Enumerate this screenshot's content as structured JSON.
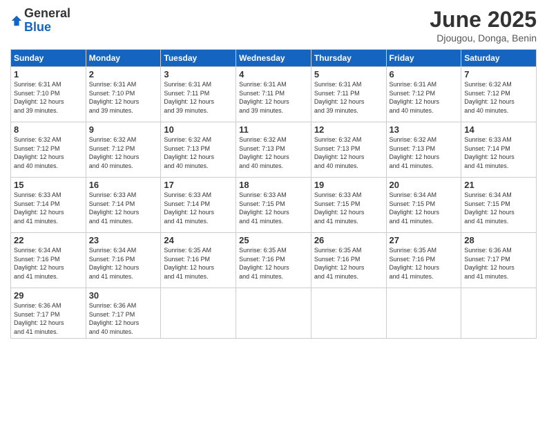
{
  "logo": {
    "general": "General",
    "blue": "Blue"
  },
  "header": {
    "month": "June 2025",
    "location": "Djougou, Donga, Benin"
  },
  "days_of_week": [
    "Sunday",
    "Monday",
    "Tuesday",
    "Wednesday",
    "Thursday",
    "Friday",
    "Saturday"
  ],
  "weeks": [
    [
      {
        "day": "1",
        "sunrise": "6:31 AM",
        "sunset": "7:10 PM",
        "daylight": "12 hours and 39 minutes."
      },
      {
        "day": "2",
        "sunrise": "6:31 AM",
        "sunset": "7:10 PM",
        "daylight": "12 hours and 39 minutes."
      },
      {
        "day": "3",
        "sunrise": "6:31 AM",
        "sunset": "7:11 PM",
        "daylight": "12 hours and 39 minutes."
      },
      {
        "day": "4",
        "sunrise": "6:31 AM",
        "sunset": "7:11 PM",
        "daylight": "12 hours and 39 minutes."
      },
      {
        "day": "5",
        "sunrise": "6:31 AM",
        "sunset": "7:11 PM",
        "daylight": "12 hours and 39 minutes."
      },
      {
        "day": "6",
        "sunrise": "6:31 AM",
        "sunset": "7:12 PM",
        "daylight": "12 hours and 40 minutes."
      },
      {
        "day": "7",
        "sunrise": "6:32 AM",
        "sunset": "7:12 PM",
        "daylight": "12 hours and 40 minutes."
      }
    ],
    [
      {
        "day": "8",
        "sunrise": "6:32 AM",
        "sunset": "7:12 PM",
        "daylight": "12 hours and 40 minutes."
      },
      {
        "day": "9",
        "sunrise": "6:32 AM",
        "sunset": "7:12 PM",
        "daylight": "12 hours and 40 minutes."
      },
      {
        "day": "10",
        "sunrise": "6:32 AM",
        "sunset": "7:13 PM",
        "daylight": "12 hours and 40 minutes."
      },
      {
        "day": "11",
        "sunrise": "6:32 AM",
        "sunset": "7:13 PM",
        "daylight": "12 hours and 40 minutes."
      },
      {
        "day": "12",
        "sunrise": "6:32 AM",
        "sunset": "7:13 PM",
        "daylight": "12 hours and 40 minutes."
      },
      {
        "day": "13",
        "sunrise": "6:32 AM",
        "sunset": "7:13 PM",
        "daylight": "12 hours and 41 minutes."
      },
      {
        "day": "14",
        "sunrise": "6:33 AM",
        "sunset": "7:14 PM",
        "daylight": "12 hours and 41 minutes."
      }
    ],
    [
      {
        "day": "15",
        "sunrise": "6:33 AM",
        "sunset": "7:14 PM",
        "daylight": "12 hours and 41 minutes."
      },
      {
        "day": "16",
        "sunrise": "6:33 AM",
        "sunset": "7:14 PM",
        "daylight": "12 hours and 41 minutes."
      },
      {
        "day": "17",
        "sunrise": "6:33 AM",
        "sunset": "7:14 PM",
        "daylight": "12 hours and 41 minutes."
      },
      {
        "day": "18",
        "sunrise": "6:33 AM",
        "sunset": "7:15 PM",
        "daylight": "12 hours and 41 minutes."
      },
      {
        "day": "19",
        "sunrise": "6:33 AM",
        "sunset": "7:15 PM",
        "daylight": "12 hours and 41 minutes."
      },
      {
        "day": "20",
        "sunrise": "6:34 AM",
        "sunset": "7:15 PM",
        "daylight": "12 hours and 41 minutes."
      },
      {
        "day": "21",
        "sunrise": "6:34 AM",
        "sunset": "7:15 PM",
        "daylight": "12 hours and 41 minutes."
      }
    ],
    [
      {
        "day": "22",
        "sunrise": "6:34 AM",
        "sunset": "7:16 PM",
        "daylight": "12 hours and 41 minutes."
      },
      {
        "day": "23",
        "sunrise": "6:34 AM",
        "sunset": "7:16 PM",
        "daylight": "12 hours and 41 minutes."
      },
      {
        "day": "24",
        "sunrise": "6:35 AM",
        "sunset": "7:16 PM",
        "daylight": "12 hours and 41 minutes."
      },
      {
        "day": "25",
        "sunrise": "6:35 AM",
        "sunset": "7:16 PM",
        "daylight": "12 hours and 41 minutes."
      },
      {
        "day": "26",
        "sunrise": "6:35 AM",
        "sunset": "7:16 PM",
        "daylight": "12 hours and 41 minutes."
      },
      {
        "day": "27",
        "sunrise": "6:35 AM",
        "sunset": "7:16 PM",
        "daylight": "12 hours and 41 minutes."
      },
      {
        "day": "28",
        "sunrise": "6:36 AM",
        "sunset": "7:17 PM",
        "daylight": "12 hours and 41 minutes."
      }
    ],
    [
      {
        "day": "29",
        "sunrise": "6:36 AM",
        "sunset": "7:17 PM",
        "daylight": "12 hours and 41 minutes."
      },
      {
        "day": "30",
        "sunrise": "6:36 AM",
        "sunset": "7:17 PM",
        "daylight": "12 hours and 40 minutes."
      },
      null,
      null,
      null,
      null,
      null
    ]
  ]
}
